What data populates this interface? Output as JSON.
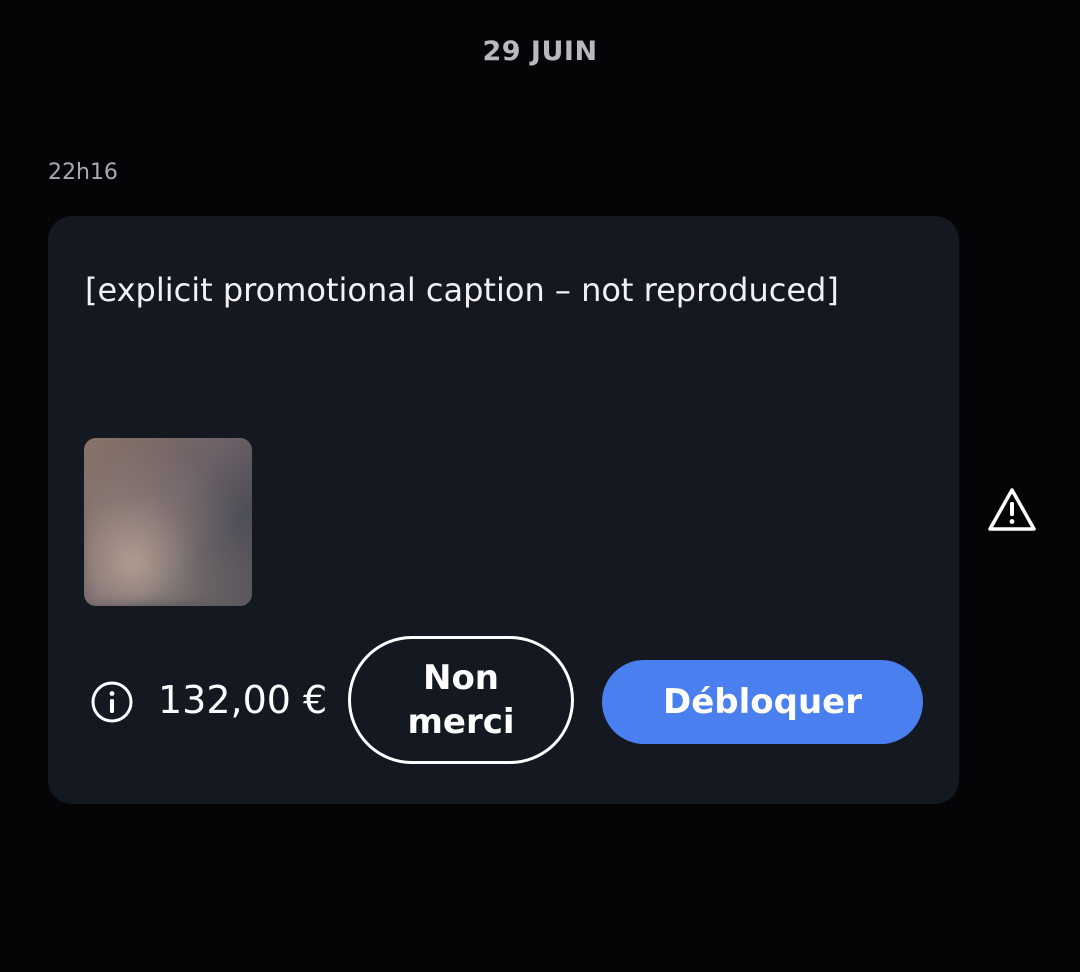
{
  "conversation": {
    "date_divider": "29 JUIN"
  },
  "message": {
    "timestamp": "22h16",
    "text": "[explicit promotional caption – not reproduced]",
    "media": {
      "state": "locked",
      "icon": "blurred-media-thumbnail"
    },
    "offer": {
      "info_icon": "info-circle-icon",
      "price": "132,00 €",
      "decline_label": "Non merci",
      "unlock_label": "Débloquer"
    }
  },
  "actions": {
    "report_icon": "warning-triangle-icon"
  },
  "colors": {
    "background": "#050508",
    "bubble": "#141821",
    "accent": "#4a7ff0",
    "muted_text": "#a9a9b0"
  }
}
